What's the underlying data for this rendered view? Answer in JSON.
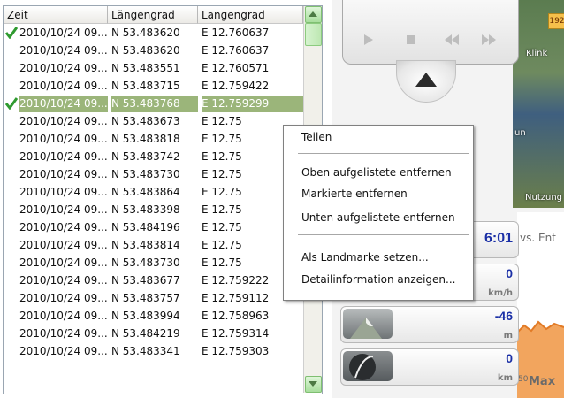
{
  "table": {
    "columns": [
      "Zeit",
      "Längengrad",
      "Langengrad"
    ],
    "rows": [
      {
        "zeit": "2010/10/24 09...",
        "lat": "N 53.483620",
        "lon": "E 12.760637",
        "checked": true,
        "selected": false
      },
      {
        "zeit": "2010/10/24 09...",
        "lat": "N 53.483620",
        "lon": "E 12.760637",
        "checked": false,
        "selected": false
      },
      {
        "zeit": "2010/10/24 09...",
        "lat": "N 53.483551",
        "lon": "E 12.760571",
        "checked": false,
        "selected": false
      },
      {
        "zeit": "2010/10/24 09...",
        "lat": "N 53.483715",
        "lon": "E 12.759422",
        "checked": false,
        "selected": false
      },
      {
        "zeit": "2010/10/24 09...",
        "lat": "N 53.483768",
        "lon": "E 12.759299",
        "checked": true,
        "selected": true
      },
      {
        "zeit": "2010/10/24 09...",
        "lat": "N 53.483673",
        "lon": "E 12.75",
        "checked": false,
        "selected": false
      },
      {
        "zeit": "2010/10/24 09...",
        "lat": "N 53.483818",
        "lon": "E 12.75",
        "checked": false,
        "selected": false
      },
      {
        "zeit": "2010/10/24 09...",
        "lat": "N 53.483742",
        "lon": "E 12.75",
        "checked": false,
        "selected": false
      },
      {
        "zeit": "2010/10/24 09...",
        "lat": "N 53.483730",
        "lon": "E 12.75",
        "checked": false,
        "selected": false
      },
      {
        "zeit": "2010/10/24 09...",
        "lat": "N 53.483864",
        "lon": "E 12.75",
        "checked": false,
        "selected": false
      },
      {
        "zeit": "2010/10/24 09...",
        "lat": "N 53.483398",
        "lon": "E 12.75",
        "checked": false,
        "selected": false
      },
      {
        "zeit": "2010/10/24 09...",
        "lat": "N 53.484196",
        "lon": "E 12.75",
        "checked": false,
        "selected": false
      },
      {
        "zeit": "2010/10/24 09...",
        "lat": "N 53.483814",
        "lon": "E 12.75",
        "checked": false,
        "selected": false
      },
      {
        "zeit": "2010/10/24 09...",
        "lat": "N 53.483730",
        "lon": "E 12.75",
        "checked": false,
        "selected": false
      },
      {
        "zeit": "2010/10/24 09...",
        "lat": "N 53.483677",
        "lon": "E 12.759222",
        "checked": false,
        "selected": false
      },
      {
        "zeit": "2010/10/24 09...",
        "lat": "N 53.483757",
        "lon": "E 12.759112",
        "checked": false,
        "selected": false
      },
      {
        "zeit": "2010/10/24 09...",
        "lat": "N 53.483994",
        "lon": "E 12.758963",
        "checked": false,
        "selected": false
      },
      {
        "zeit": "2010/10/24 09...",
        "lat": "N 53.484219",
        "lon": "E 12.759314",
        "checked": false,
        "selected": false
      },
      {
        "zeit": "2010/10/24 09...",
        "lat": "N 53.483341",
        "lon": "E 12.759303",
        "checked": false,
        "selected": false
      }
    ]
  },
  "context_menu": {
    "items": [
      "Teilen",
      "Oben aufgelistete entfernen",
      "Markierte entfernen",
      "Unten aufgelistete entfernen",
      "Als Landmarke setzen...",
      "Detailinformation anzeigen..."
    ]
  },
  "panel": {
    "time": "6:01",
    "speed": "0",
    "speed_unit": "km/h",
    "elevation": "-46",
    "elevation_unit": "m",
    "distance": "0",
    "distance_unit": "km",
    "chart_label": "vs. Ent",
    "chart_tick": "50",
    "chart_max": "Max"
  },
  "map": {
    "road_badge": "192",
    "label_klink": "Klink",
    "label_un": "un",
    "label_nutzung": "Nutzung"
  },
  "colors": {
    "selected_row": "#9bb57a",
    "check": "#2f9a2f",
    "stat_value": "#1a2fa6"
  }
}
